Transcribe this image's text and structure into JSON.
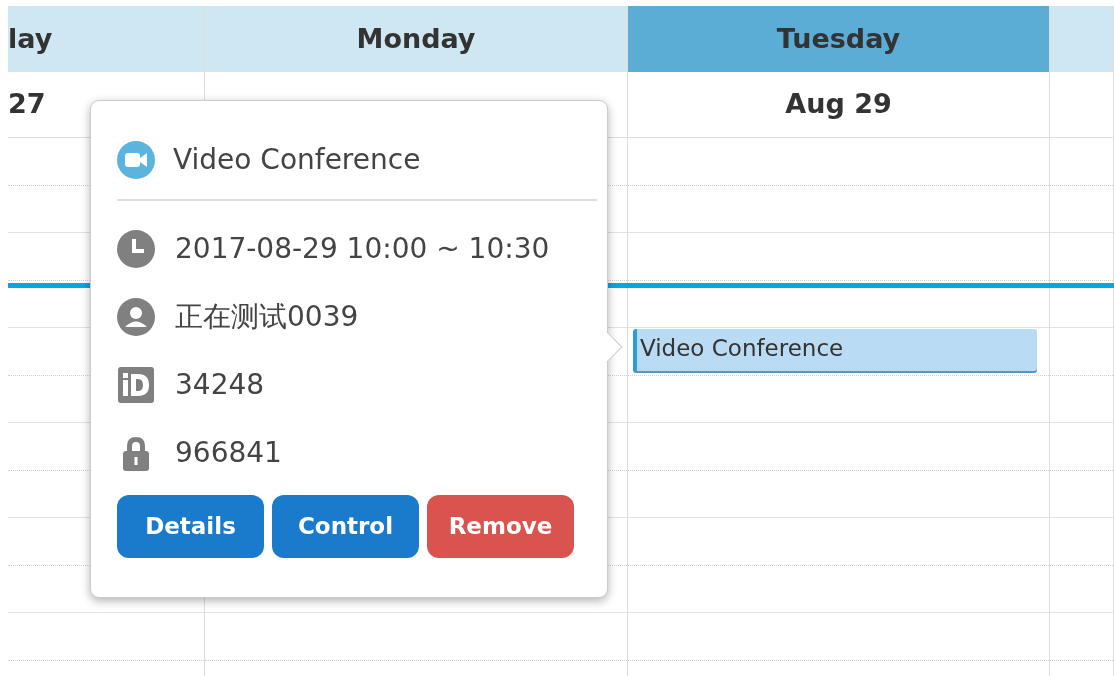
{
  "columns": [
    {
      "day": "lay",
      "date": "27",
      "selected": false
    },
    {
      "day": "Monday",
      "selected": false
    },
    {
      "day": "Tuesday",
      "date": "Aug 29",
      "selected": true,
      "events": [
        {
          "title": "Video Conference"
        }
      ]
    },
    {
      "selected": false
    }
  ],
  "popover": {
    "title": "Video Conference",
    "details": [
      {
        "kind": "time",
        "text": "2017-08-29 10:00 ~ 10:30"
      },
      {
        "kind": "user",
        "text": "正在测试0039"
      },
      {
        "kind": "id",
        "text": "34248"
      },
      {
        "kind": "password",
        "text": "966841"
      }
    ],
    "buttons": [
      {
        "label": "Details",
        "kind": "primary"
      },
      {
        "label": "Control",
        "kind": "primary"
      },
      {
        "label": "Remove",
        "kind": "danger"
      }
    ]
  }
}
